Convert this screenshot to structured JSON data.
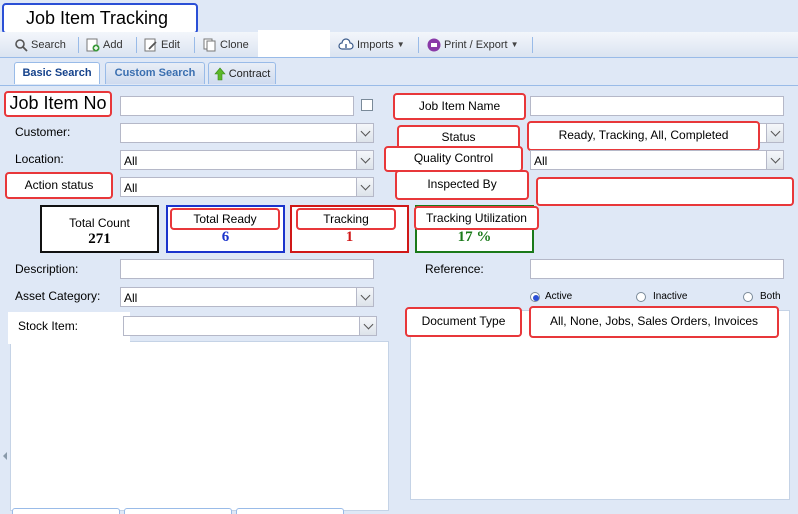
{
  "title": "Job Item Tracking",
  "toolbar": {
    "search": "Search",
    "add": "Add",
    "edit": "Edit",
    "clone": "Clone",
    "imports": "Imports",
    "print_export": "Print / Export"
  },
  "tabs": [
    "Basic Search",
    "Custom Search",
    "Contract"
  ],
  "form": {
    "job_item_no": "Job Item No",
    "job_item_name": "Job Item Name",
    "customer": "Customer:",
    "status": "Status",
    "status_value": "Ready, Tracking, All, Completed",
    "location": "Location:",
    "location_value": "All",
    "quality_control": "Quality Control",
    "quality_control_value": "All",
    "action_status": "Action status",
    "action_status_value": "All",
    "inspected_by": "Inspected By",
    "description": "Description:",
    "reference": "Reference:",
    "asset_category": "Asset Category:",
    "asset_category_value": "All",
    "stock_item": "Stock Item:",
    "document_type": "Document Type",
    "document_type_value": "All, None, Jobs, Sales Orders, Invoices"
  },
  "radios": {
    "active": "Active",
    "inactive": "Inactive",
    "both": "Both",
    "selected": "active"
  },
  "stats": [
    {
      "label": "Total Count",
      "value": "271",
      "color": "#000000"
    },
    {
      "label": "Total Ready",
      "value": "6",
      "color": "#1a33cc"
    },
    {
      "label": "Tracking",
      "value": "1",
      "color": "#d01818"
    },
    {
      "label": "Tracking Utilization",
      "value": "17 %",
      "color": "#1a7a1a"
    }
  ]
}
